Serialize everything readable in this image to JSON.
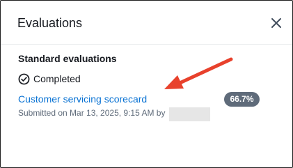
{
  "panel": {
    "title": "Evaluations",
    "close_icon": "close-icon"
  },
  "section": {
    "title": "Standard evaluations",
    "status": {
      "icon": "check-circle-icon",
      "label": "Completed"
    },
    "evaluation": {
      "name": "Customer servicing scorecard",
      "score": "66.7%",
      "submitted": "Submitted on Mar 13, 2025, 9:15 AM by"
    }
  },
  "annotation": {
    "arrow_color": "#e8412c"
  },
  "colors": {
    "link": "#0972d3",
    "badge": "#5f6b7a",
    "text": "#16191f",
    "muted": "#5f6b7a"
  }
}
